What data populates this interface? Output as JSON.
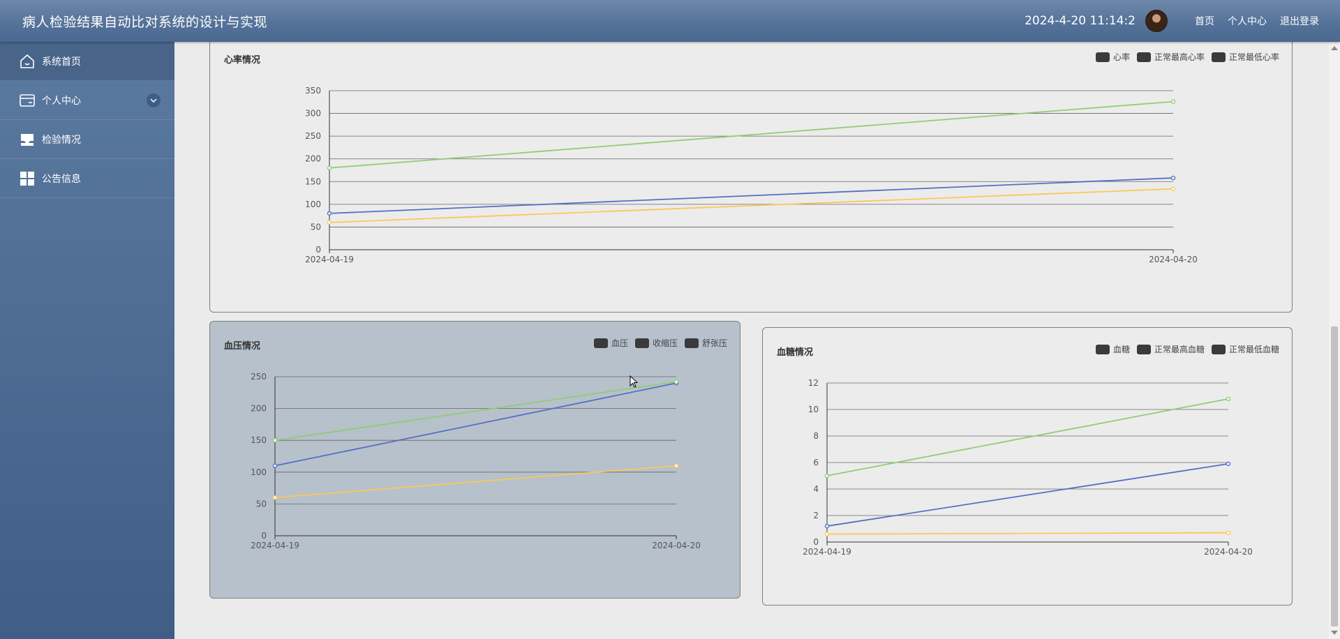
{
  "header": {
    "title": "病人检验结果自动比对系统的设计与实现",
    "datetime": "2024-4-20 11:14:2",
    "links": [
      "首页",
      "个人中心",
      "退出登录"
    ]
  },
  "sidebar": {
    "items": [
      {
        "label": "系统首页",
        "icon": "home-icon"
      },
      {
        "label": "个人中心",
        "icon": "card-icon"
      },
      {
        "label": "检验情况",
        "icon": "inbox-icon"
      },
      {
        "label": "公告信息",
        "icon": "grid-icon"
      }
    ]
  },
  "colors": {
    "blue": "#5470c6",
    "green": "#91cc75",
    "orange": "#fac858"
  },
  "chart_data": [
    {
      "type": "line",
      "title": "心率情况",
      "x": [
        "2024-04-19",
        "2024-04-20"
      ],
      "ylim": [
        0,
        350
      ],
      "yticks": [
        0,
        50,
        100,
        150,
        200,
        250,
        300,
        350
      ],
      "legend": [
        "心率",
        "正常最高心率",
        "正常最低心率"
      ],
      "series": [
        {
          "values": [
            80,
            158
          ],
          "color": "#5470c6"
        },
        {
          "values": [
            180,
            326
          ],
          "color": "#91cc75"
        },
        {
          "values": [
            60,
            134
          ],
          "color": "#fac858"
        }
      ]
    },
    {
      "type": "line",
      "title": "血压情况",
      "x": [
        "2024-04-19",
        "2024-04-20"
      ],
      "ylim": [
        0,
        250
      ],
      "yticks": [
        0,
        50,
        100,
        150,
        200,
        250
      ],
      "legend": [
        "血压",
        "收缩压",
        "舒张压"
      ],
      "series": [
        {
          "values": [
            110,
            240
          ],
          "color": "#5470c6"
        },
        {
          "values": [
            150,
            242
          ],
          "color": "#91cc75"
        },
        {
          "values": [
            60,
            110
          ],
          "color": "#fac858"
        }
      ]
    },
    {
      "type": "line",
      "title": "血糖情况",
      "x": [
        "2024-04-19",
        "2024-04-20"
      ],
      "ylim": [
        0,
        12
      ],
      "yticks": [
        0,
        2,
        4,
        6,
        8,
        10,
        12
      ],
      "legend": [
        "血糖",
        "正常最高血糖",
        "正常最低血糖"
      ],
      "series": [
        {
          "values": [
            1.2,
            5.9
          ],
          "color": "#5470c6"
        },
        {
          "values": [
            5,
            10.8
          ],
          "color": "#91cc75"
        },
        {
          "values": [
            0.6,
            0.7
          ],
          "color": "#fac858"
        }
      ]
    }
  ]
}
